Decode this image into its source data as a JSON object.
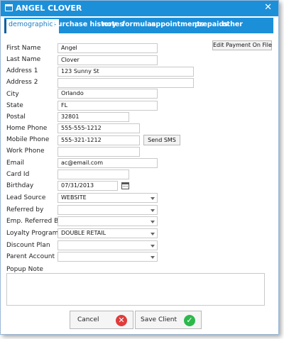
{
  "window": {
    "title": "ANGEL CLOVER",
    "titlebar_color": "#1c8fd9",
    "title_icon": "window-icon",
    "close_icon": "close-icon",
    "close_glyph": "✕"
  },
  "tabs": [
    {
      "label": "demographics",
      "active": true
    },
    {
      "label": "purchase history",
      "active": false
    },
    {
      "label": "notes",
      "active": false
    },
    {
      "label": "formulas",
      "active": false
    },
    {
      "label": "appointments",
      "active": false
    },
    {
      "label": "prepaids",
      "active": false
    },
    {
      "label": "other",
      "active": false
    }
  ],
  "actions": {
    "edit_payment": "Edit Payment On File",
    "send_sms": "Send SMS"
  },
  "fields": {
    "first_name": {
      "label": "First Name",
      "value": "Angel"
    },
    "last_name": {
      "label": "Last Name",
      "value": "Clover"
    },
    "address1": {
      "label": "Address 1",
      "value": "123 Sunny St"
    },
    "address2": {
      "label": "Address 2",
      "value": ""
    },
    "city": {
      "label": "City",
      "value": "Orlando"
    },
    "state": {
      "label": "State",
      "value": "FL"
    },
    "postal": {
      "label": "Postal",
      "value": "32801"
    },
    "home_phone": {
      "label": "Home Phone",
      "value": "555-555-1212"
    },
    "mobile_phone": {
      "label": "Mobile Phone",
      "value": "555-321-1212"
    },
    "work_phone": {
      "label": "Work Phone",
      "value": ""
    },
    "email": {
      "label": "Email",
      "value": "ac@email.com"
    },
    "card_id": {
      "label": "Card Id",
      "value": ""
    },
    "birthday": {
      "label": "Birthday",
      "value": "07/31/2013"
    },
    "lead_source": {
      "label": "Lead Source",
      "value": "WEBSITE"
    },
    "referred_by": {
      "label": "Referred by",
      "value": ""
    },
    "emp_referred_by": {
      "label": "Emp. Referred By",
      "value": ""
    },
    "loyalty_program": {
      "label": "Loyalty Program",
      "value": "DOUBLE RETAIL"
    },
    "discount_plan": {
      "label": "Discount Plan",
      "value": ""
    },
    "parent_account": {
      "label": "Parent Account",
      "value": ""
    }
  },
  "popup_note": {
    "label": "Popup Note",
    "value": ""
  },
  "footer": {
    "cancel_label": "Cancel",
    "cancel_icon_glyph": "✕",
    "cancel_color": "#e03b3b",
    "save_label": "Save Client",
    "save_icon_glyph": "✓",
    "save_color": "#2db84c"
  }
}
